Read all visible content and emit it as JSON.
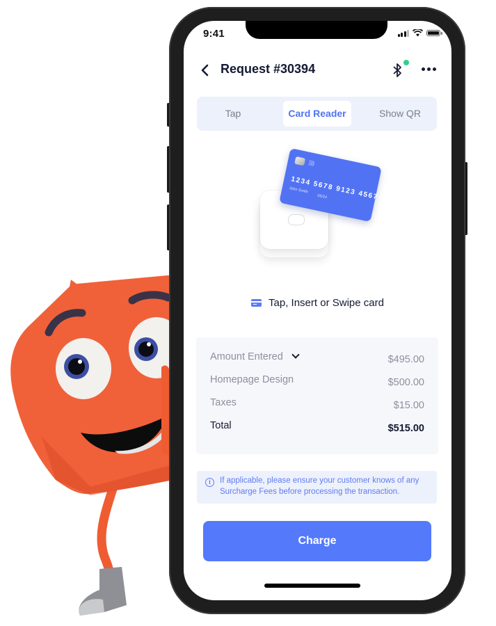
{
  "status_bar": {
    "time": "9:41"
  },
  "header": {
    "title": "Request #30394",
    "bluetooth_connected_color": "#2fd08f"
  },
  "tabs": [
    {
      "label": "Tap",
      "active": false
    },
    {
      "label": "Card Reader",
      "active": true
    },
    {
      "label": "Show QR",
      "active": false
    }
  ],
  "card_illustration": {
    "number": "1234 5678 9123 4567",
    "holder": "John Smith",
    "expiry": "05/24"
  },
  "prompt": "Tap, Insert or Swipe card",
  "summary": {
    "rows": [
      {
        "label": "Amount Entered",
        "value": "$495.00",
        "expandable": true
      },
      {
        "label": "Homepage Design",
        "value": "$500.00"
      },
      {
        "label": "Taxes",
        "value": "$15.00"
      }
    ],
    "total": {
      "label": "Total",
      "value": "$515.00"
    }
  },
  "notice": "If applicable, please ensure your customer knows of any Surcharge Fees before processing the transaction.",
  "charge_button": "Charge",
  "colors": {
    "accent": "#5479fb",
    "tab_bg": "#edf1fc",
    "text_dark": "#141a33",
    "mascot_orange": "#f0613a"
  }
}
